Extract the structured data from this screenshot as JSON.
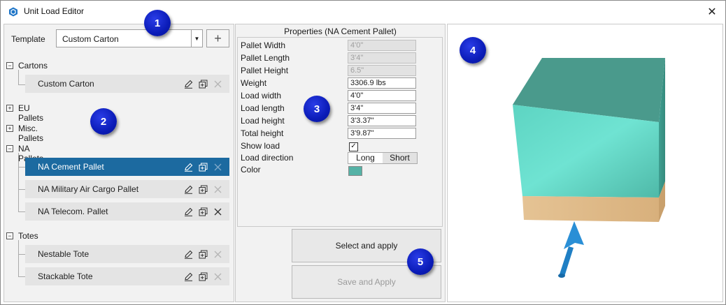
{
  "window": {
    "title": "Unit Load Editor",
    "close_icon": "close-icon"
  },
  "template": {
    "label": "Template",
    "value": "Custom Carton",
    "add_label": "+"
  },
  "tree": {
    "groups": [
      {
        "label": "Cartons",
        "toggle": "−"
      },
      {
        "label": "EU Pallets",
        "toggle": "+"
      },
      {
        "label": "Misc. Pallets",
        "toggle": "+"
      },
      {
        "label": "NA Pallets",
        "toggle": "−"
      },
      {
        "label": "Totes",
        "toggle": "−"
      }
    ],
    "items": [
      {
        "label": "Custom Carton",
        "selected": false
      },
      {
        "label": "NA Cement Pallet",
        "selected": true
      },
      {
        "label": "NA Military Air Cargo Pallet",
        "selected": false
      },
      {
        "label": "NA Telecom. Pallet",
        "selected": false
      },
      {
        "label": "Nestable Tote",
        "selected": false
      },
      {
        "label": "Stackable Tote",
        "selected": false
      }
    ]
  },
  "properties": {
    "title": "Properties (NA Cement Pallet)",
    "rows": [
      {
        "label": "Pallet Width",
        "value": "4'0\"",
        "readonly": true
      },
      {
        "label": "Pallet Length",
        "value": "3'4\"",
        "readonly": true
      },
      {
        "label": "Pallet Height",
        "value": "6.5\"",
        "readonly": true
      },
      {
        "label": "Weight",
        "value": "3306.9 lbs",
        "readonly": false
      },
      {
        "label": "Load width",
        "value": "4'0\"",
        "readonly": false
      },
      {
        "label": "Load length",
        "value": "3'4\"",
        "readonly": false
      },
      {
        "label": "Load height",
        "value": "3'3.37\"",
        "readonly": false
      },
      {
        "label": "Total height",
        "value": "3'9.87\"",
        "readonly": false
      }
    ],
    "show_load": {
      "label": "Show load",
      "checked": true,
      "mark": "✓"
    },
    "load_direction": {
      "label": "Load direction",
      "options": [
        "Long",
        "Short"
      ],
      "selected": "Long"
    },
    "color": {
      "label": "Color",
      "value": "#55b2a6"
    }
  },
  "buttons": {
    "select_apply": "Select and apply",
    "save_apply": "Save and Apply"
  },
  "callouts": [
    "1",
    "2",
    "3",
    "4",
    "5"
  ],
  "colors": {
    "selection": "#1c6aa0",
    "load_top": "#4a9a8c",
    "load_front": "#6ee0cf",
    "pallet": "#e8c59a",
    "arrow": "#1f7fc4"
  }
}
